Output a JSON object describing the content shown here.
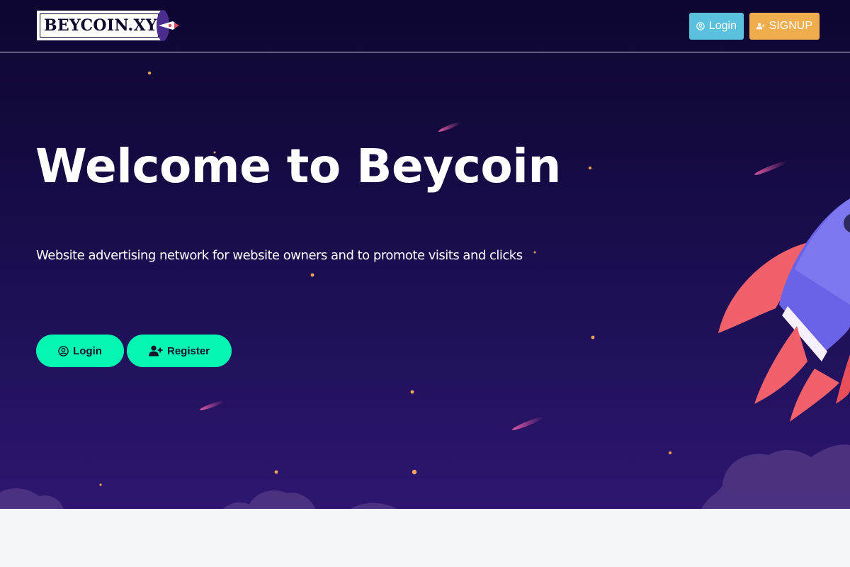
{
  "brand": {
    "logo_text": "BEYCOIN.XYZ"
  },
  "navbar": {
    "login_label": "Login",
    "signup_label": "SIGNUP"
  },
  "hero": {
    "title": "Welcome to Beycoin",
    "subtitle": "Website advertising network for website owners and to promote visits and clicks",
    "login_label": "Login",
    "register_label": "Register"
  },
  "colors": {
    "background_top": "#0d0630",
    "background_bottom": "#2e1670",
    "nav_login_button": "#5bc0de",
    "nav_signup_button": "#f0ad4e",
    "cta_button": "#05f5b2",
    "rocket_body": "#6a63e8",
    "rocket_fins": "#f0616b",
    "stars": "#f3a45c",
    "meteors": "#e45aa8",
    "clouds": "#5a3e8e"
  },
  "icons": {
    "nav_login": "user-circle-icon",
    "nav_signup": "user-plus-icon",
    "cta_login": "user-circle-icon",
    "cta_register": "user-plus-icon",
    "illustration": "rocket-icon"
  }
}
